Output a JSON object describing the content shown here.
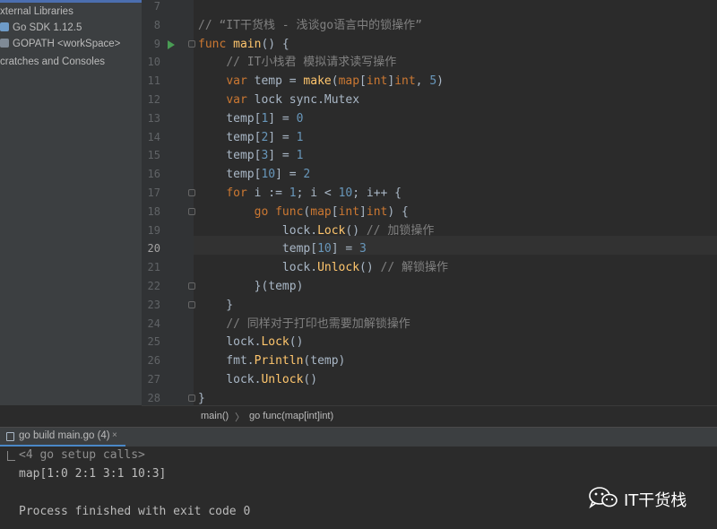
{
  "project_tree": {
    "items": [
      {
        "label": "xternal Libraries"
      },
      {
        "label": "Go SDK 1.12.5",
        "icon": "sdk-icon"
      },
      {
        "label": "GOPATH <workSpace>",
        "icon": "folder-icon"
      },
      {
        "label": "cratches and Consoles"
      }
    ]
  },
  "editor": {
    "current_line": 20,
    "lines": [
      {
        "n": "7",
        "html": ""
      },
      {
        "n": "8",
        "html": "<span class=\"cmt\">// “IT干货栈 - 浅谈go语言中的锁操作”</span>"
      },
      {
        "n": "9",
        "html": "<span class=\"kw\">func</span> <span class=\"fn\">main</span>() {"
      },
      {
        "n": "10",
        "html": "    <span class=\"cmt\">// IT小栈君 模拟请求读写操作</span>"
      },
      {
        "n": "11",
        "html": "    <span class=\"kw\">var</span> temp = <span class=\"fn\">make</span>(<span class=\"kw\">map</span>[<span class=\"kw\">int</span>]<span class=\"kw\">int</span>, <span class=\"num-lit\">5</span>)"
      },
      {
        "n": "12",
        "html": "    <span class=\"kw\">var</span> lock sync.Mutex"
      },
      {
        "n": "13",
        "html": "    temp[<span class=\"num-lit\">1</span>] = <span class=\"num-lit\">0</span>"
      },
      {
        "n": "14",
        "html": "    temp[<span class=\"num-lit\">2</span>] = <span class=\"num-lit\">1</span>"
      },
      {
        "n": "15",
        "html": "    temp[<span class=\"num-lit\">3</span>] = <span class=\"num-lit\">1</span>"
      },
      {
        "n": "16",
        "html": "    temp[<span class=\"num-lit\">10</span>] = <span class=\"num-lit\">2</span>"
      },
      {
        "n": "17",
        "html": "    <span class=\"kw\">for</span> i := <span class=\"num-lit\">1</span>; i &lt; <span class=\"num-lit\">10</span>; i++ {"
      },
      {
        "n": "18",
        "html": "        <span class=\"kw\">go</span> <span class=\"kw\">func</span>(<span class=\"kw\">map</span>[<span class=\"kw\">int</span>]<span class=\"kw\">int</span>) {"
      },
      {
        "n": "19",
        "html": "            lock.<span class=\"fn\">Lock</span>() <span class=\"cmt\">// 加锁操作</span>"
      },
      {
        "n": "20",
        "html": "            temp[<span class=\"num-lit\">10</span>] = <span class=\"num-lit\">3</span>"
      },
      {
        "n": "21",
        "html": "            lock.<span class=\"fn\">Unlock</span>() <span class=\"cmt\">// 解锁操作</span>"
      },
      {
        "n": "22",
        "html": "        }(temp)"
      },
      {
        "n": "23",
        "html": "    }"
      },
      {
        "n": "24",
        "html": "    <span class=\"cmt\">// 同样对于打印也需要加解锁操作</span>"
      },
      {
        "n": "25",
        "html": "    lock.<span class=\"fn\">Lock</span>()"
      },
      {
        "n": "26",
        "html": "    fmt.<span class=\"fn\">Println</span>(temp)"
      },
      {
        "n": "27",
        "html": "    lock.<span class=\"fn\">Unlock</span>()"
      },
      {
        "n": "28",
        "html": "}"
      }
    ]
  },
  "breadcrumb": {
    "item1": "main()",
    "separator": "〉",
    "item2": "go func(map[int]int)"
  },
  "run_panel": {
    "tab_label": "go build main.go (4)",
    "close_label": "×",
    "output": [
      {
        "text": "<4 go setup calls>",
        "style": "meta"
      },
      {
        "text": "map[1:0 2:1 3:1 10:3]",
        "style": "normal"
      },
      {
        "text": "",
        "style": "normal"
      },
      {
        "text": "Process finished with exit code 0",
        "style": "normal"
      }
    ]
  },
  "watermark": {
    "text": "IT干货栈",
    "icon": "wechat-icon"
  },
  "colors": {
    "keyword": "#cc7832",
    "number": "#6897bb",
    "function": "#ffc66d",
    "comment": "#808080",
    "text": "#a9b7c6",
    "background": "#2b2b2b"
  }
}
